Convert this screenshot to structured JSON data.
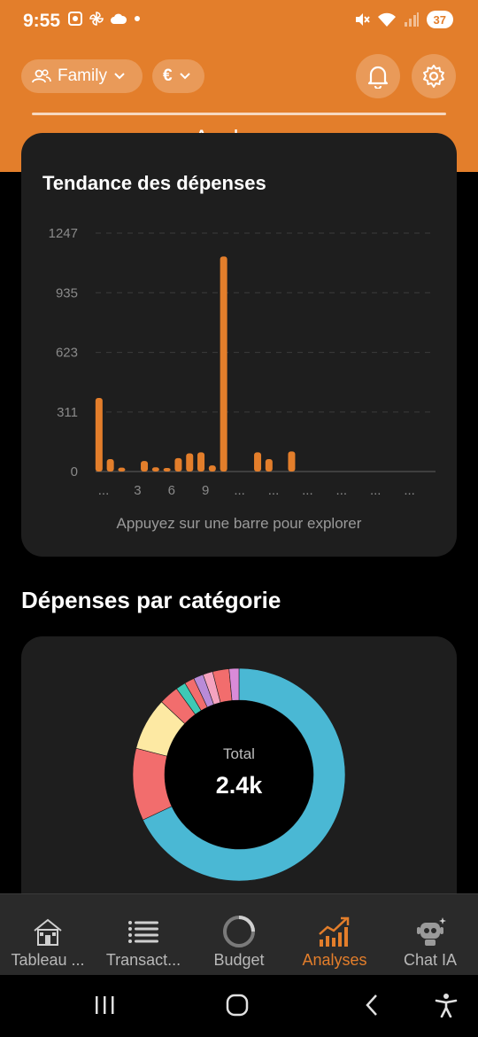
{
  "status_bar": {
    "time": "9:55",
    "battery": "37"
  },
  "header": {
    "family_chip": "Family",
    "currency_chip": "€",
    "title": "Analyses",
    "accent_color": "#e37e2b"
  },
  "trend": {
    "title": "Tendance des dépenses",
    "hint": "Appuyez sur une barre pour explorer"
  },
  "chart_data": {
    "type": "bar",
    "title": "Tendance des dépenses",
    "xlabel": "",
    "ylabel": "",
    "ylim": [
      0,
      1247
    ],
    "yticks": [
      "0",
      "311",
      "623",
      "935",
      "1247"
    ],
    "xticks": [
      "...",
      "3",
      "6",
      "9",
      "...",
      "...",
      "...",
      "...",
      "...",
      "..."
    ],
    "values": [
      385,
      65,
      20,
      0,
      55,
      22,
      6,
      70,
      95,
      100,
      32,
      1125,
      0,
      0,
      100,
      65,
      0,
      105,
      0,
      0,
      0,
      0,
      0,
      0,
      0,
      0,
      0,
      0,
      0,
      0
    ],
    "color": "#e37e2b"
  },
  "categories": {
    "title": "Dépenses par catégorie",
    "total_label": "Total",
    "total_value": "2.4k",
    "donut": {
      "type": "pie",
      "slices": [
        {
          "value": 68,
          "color": "#4ab8d4"
        },
        {
          "value": 11,
          "color": "#f26d6d"
        },
        {
          "value": 8,
          "color": "#fde9a3"
        },
        {
          "value": 3,
          "color": "#f26d6d"
        },
        {
          "value": 1.5,
          "color": "#3ec9b5"
        },
        {
          "value": 1.5,
          "color": "#f26d6d"
        },
        {
          "value": 1.5,
          "color": "#b98bd8"
        },
        {
          "value": 1.5,
          "color": "#f5a3c0"
        },
        {
          "value": 2.5,
          "color": "#f26d6d"
        },
        {
          "value": 1.5,
          "color": "#d98bd8"
        }
      ]
    }
  },
  "bottom_nav": [
    {
      "label": "Tableau ...",
      "active": false,
      "icon": "house-icon"
    },
    {
      "label": "Transact...",
      "active": false,
      "icon": "list-icon"
    },
    {
      "label": "Budget",
      "active": false,
      "icon": "ring-icon"
    },
    {
      "label": "Analyses",
      "active": true,
      "icon": "trend-up-icon"
    },
    {
      "label": "Chat IA",
      "active": false,
      "icon": "robot-icon"
    }
  ]
}
